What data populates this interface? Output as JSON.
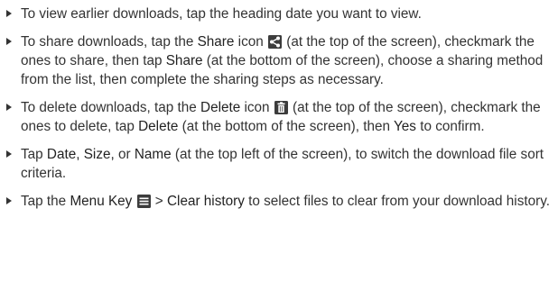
{
  "items": [
    {
      "text_1": "To view earlier downloads, tap the heading date you want to view."
    },
    {
      "text_1": "To share downloads, tap the ",
      "kw_1": "Share",
      "text_2": " icon",
      "icon": "share-icon",
      "text_3": " (at the top of the screen), checkmark the ones to share, then tap ",
      "kw_2": "Share",
      "text_4": " (at the bottom of the screen), choose a sharing method from the list, then complete the sharing steps as necessary."
    },
    {
      "text_1": "To delete downloads, tap the ",
      "kw_1": "Delete",
      "text_2": " icon",
      "icon": "trash-icon",
      "text_3": " (at the top of the screen), checkmark the ones to delete, tap ",
      "kw_2": "Delete",
      "text_4": " (at the bottom of the screen), then ",
      "kw_3": "Yes",
      "text_5": " to confirm."
    },
    {
      "text_1": "Tap ",
      "kw_1": "Date, Size,",
      "text_2": " or ",
      "kw_2": "Name",
      "text_3": " (at the top left of the screen), to switch the download file sort criteria."
    },
    {
      "text_1": "Tap the ",
      "kw_1": "Menu Key",
      "icon": "menu-icon",
      "text_2": " > ",
      "kw_2": "Clear history",
      "text_3": " to select files to clear from your download history."
    }
  ],
  "colors": {
    "text": "#333333",
    "icon_dark": "#3c3c3c",
    "icon_light": "#ffffff"
  }
}
